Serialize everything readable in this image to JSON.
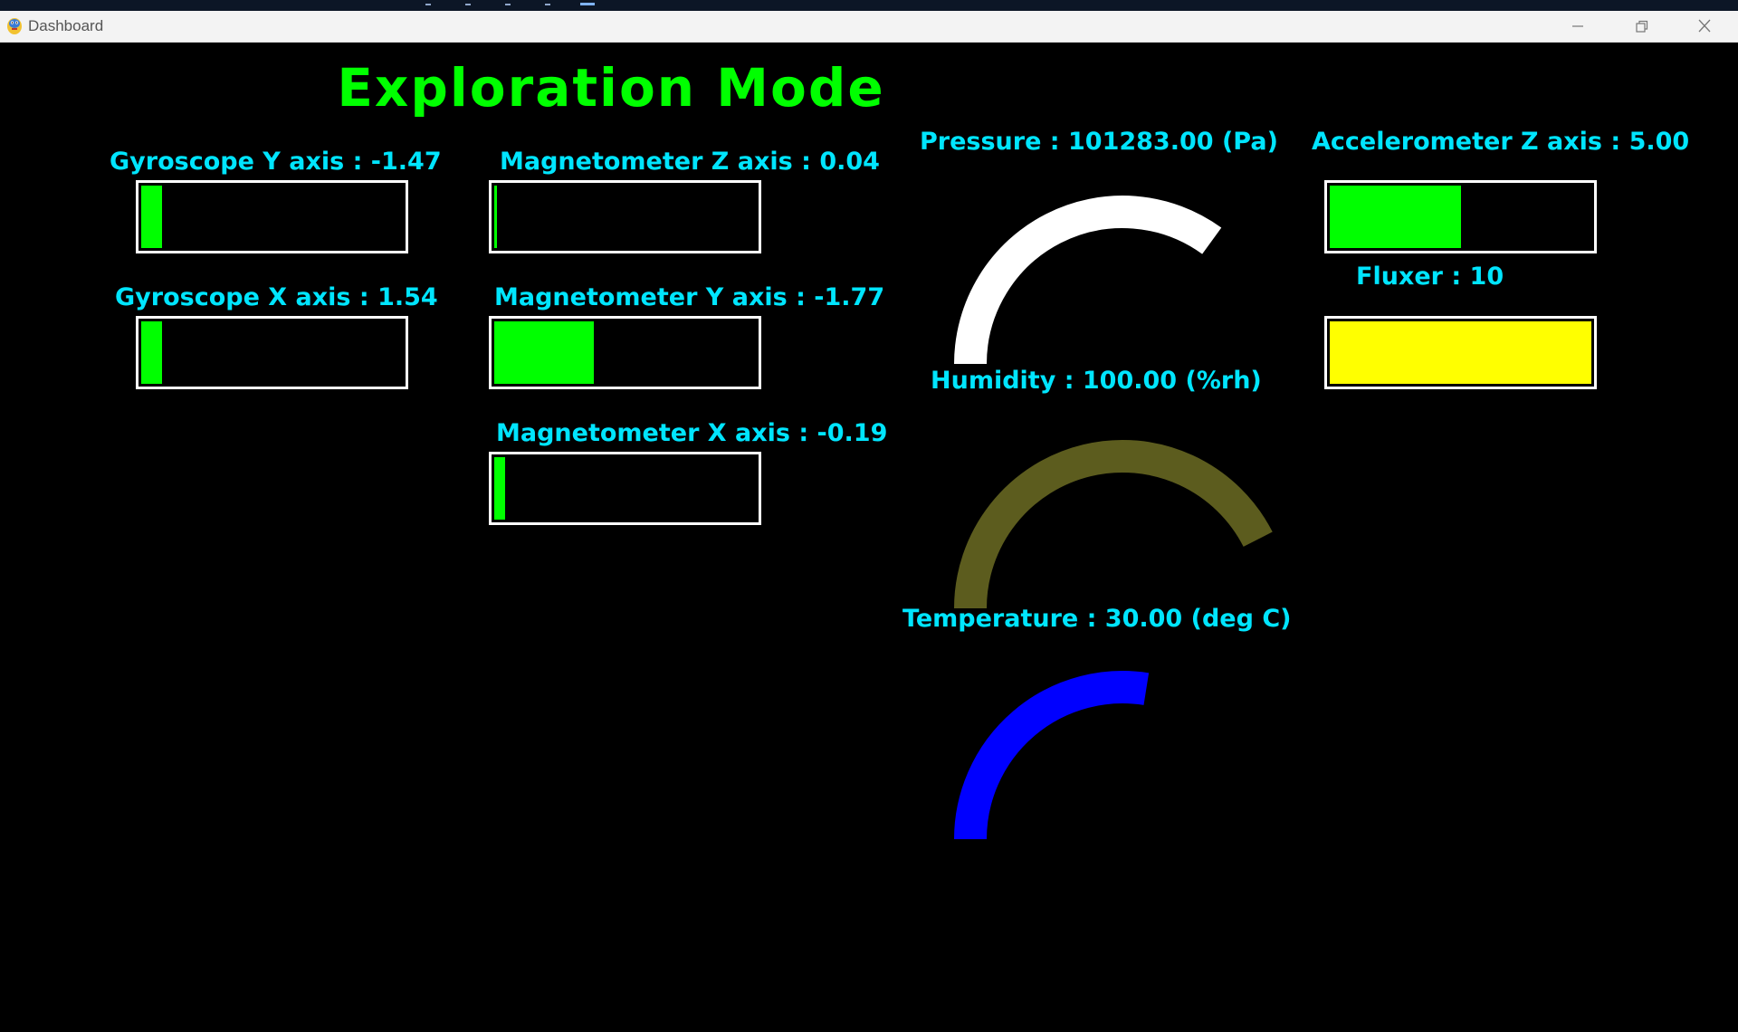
{
  "window": {
    "title": "Dashboard",
    "minimize_icon": "minimize-icon",
    "maximize_icon": "restore-icon",
    "close_icon": "close-icon"
  },
  "dashboard": {
    "heading": "Exploration Mode",
    "colors": {
      "heading": "#00ff00",
      "label": "#00e5ff",
      "bar_fill": "#00ff00",
      "flux_fill": "#ffff00",
      "pressure_arc": "#ffffff",
      "humidity_arc": "#5c5c1e",
      "temperature_arc": "#0000ff"
    },
    "bars": {
      "gyro_y": {
        "label": "Gyroscope Y axis : -1.47",
        "fill_fraction": 0.08
      },
      "gyro_x": {
        "label": "Gyroscope X axis : 1.54",
        "fill_fraction": 0.08
      },
      "mag_z": {
        "label": "Magnetometer Z axis : 0.04",
        "fill_fraction": 0.01
      },
      "mag_y": {
        "label": "Magnetometer Y axis : -1.77",
        "fill_fraction": 0.38
      },
      "mag_x": {
        "label": "Magnetometer X axis : -0.19",
        "fill_fraction": 0.04
      },
      "accel_z": {
        "label": "Accelerometer Z axis : 5.00",
        "fill_fraction": 0.5
      },
      "fluxer": {
        "label": "Fluxer : 10",
        "fill_fraction": 1.0
      }
    },
    "gauges": {
      "pressure": {
        "label": "Pressure : 101283.00 (Pa)",
        "fill_fraction": 0.7
      },
      "humidity": {
        "label": "Humidity : 100.00 (%rh)",
        "fill_fraction": 0.85
      },
      "temperature": {
        "label": "Temperature : 30.00 (deg C)",
        "fill_fraction": 0.55
      }
    }
  }
}
